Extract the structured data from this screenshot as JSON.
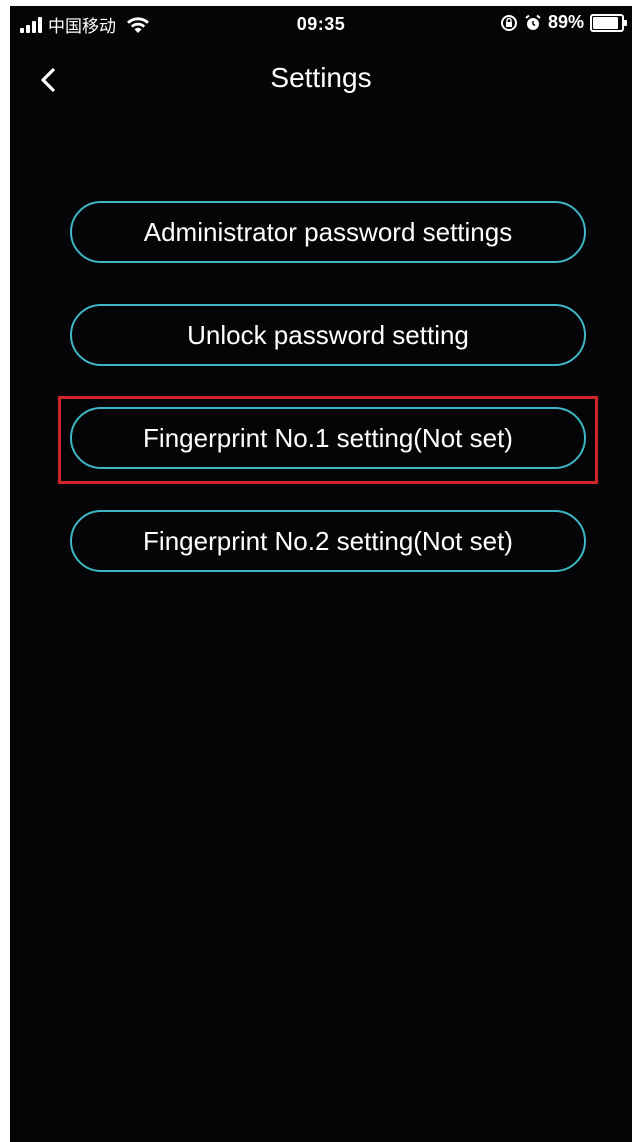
{
  "status_bar": {
    "carrier": "中国移动",
    "time": "09:35",
    "battery_percent": "89%",
    "battery_level": 0.89,
    "icons": [
      "signal-icon",
      "wifi-icon",
      "rotation-lock-icon",
      "alarm-icon",
      "battery-icon"
    ]
  },
  "nav": {
    "title": "Settings",
    "back_icon": "chevron-left-icon"
  },
  "menu": {
    "items": [
      {
        "label": "Administrator password settings"
      },
      {
        "label": "Unlock password setting"
      },
      {
        "label": "Fingerprint No.1 setting(Not set)",
        "highlighted": true
      },
      {
        "label": "Fingerprint No.2 setting(Not set)"
      }
    ]
  },
  "colors": {
    "background": "#050507",
    "button_border": "#3fb6c6",
    "highlight": "#d0252f",
    "text": "#ffffff"
  }
}
